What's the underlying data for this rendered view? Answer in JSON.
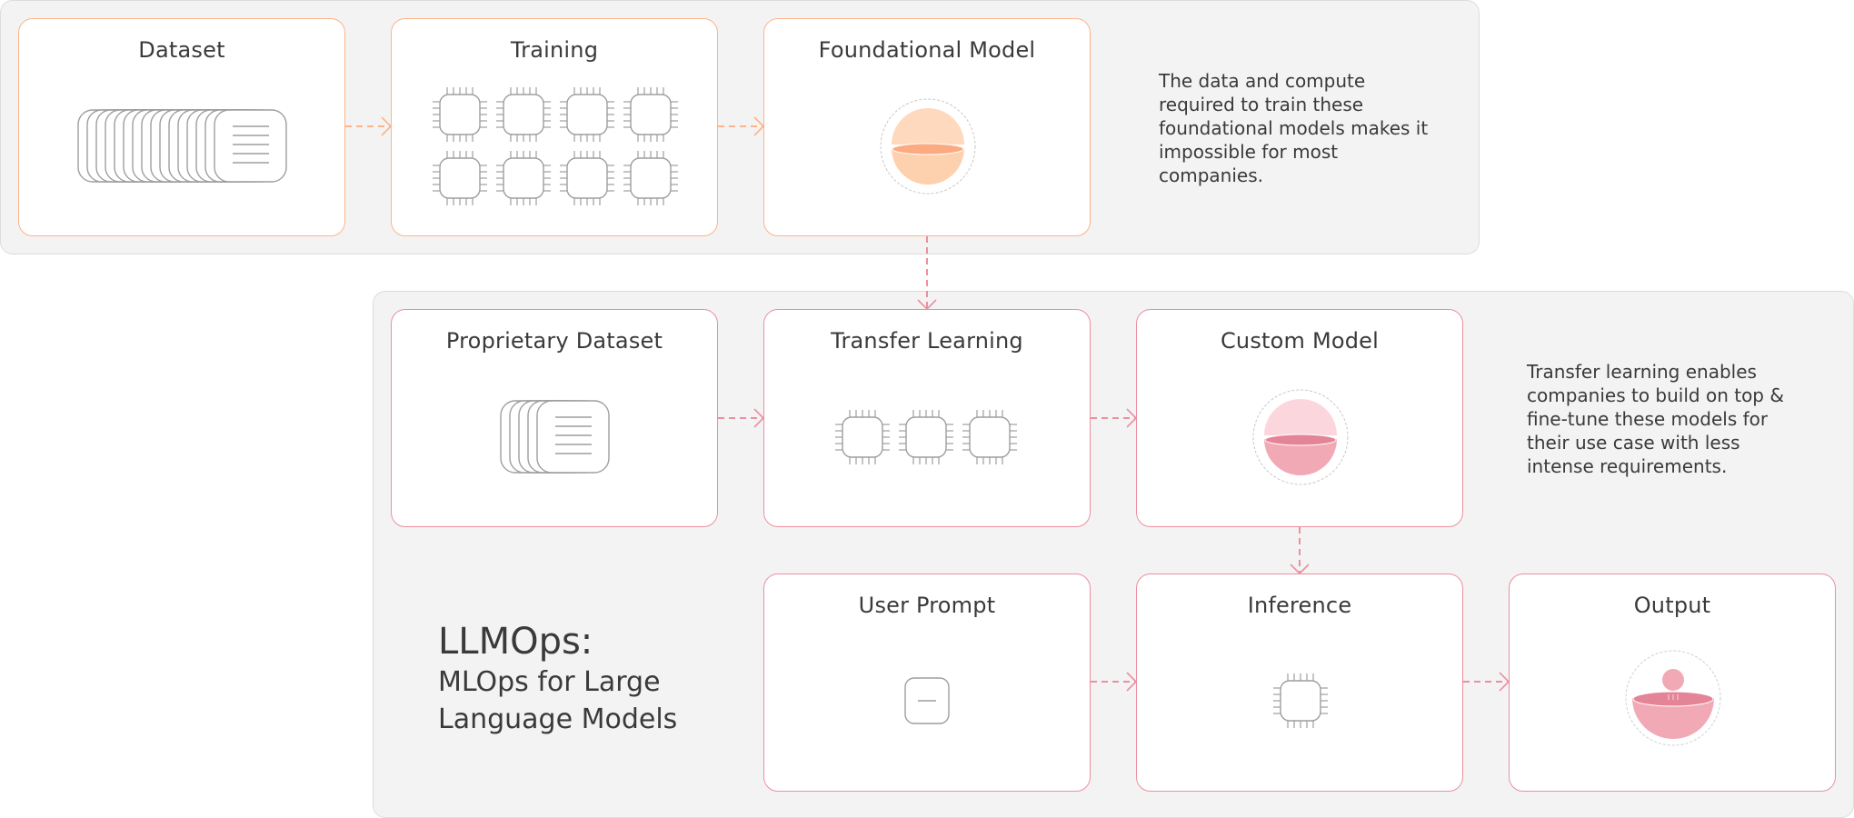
{
  "colors": {
    "top_accent": "#fdb48a",
    "bottom_accent": "#ec8fa0",
    "panel_bg": "#f3f3f3",
    "icon_stroke": "#9e9e9e",
    "orange_light": "#fed9bd",
    "orange_mid": "#fdd0ae",
    "orange_dark": "#fcaa82",
    "pink_light": "#fbd6dd",
    "pink_mid": "#f1aab5",
    "pink_dark": "#e48597"
  },
  "top_panel": {
    "boxes": [
      {
        "id": "dataset",
        "title": "Dataset",
        "icon": "document-stack-icon"
      },
      {
        "id": "training",
        "title": "Training",
        "icon": "chip-grid-icon"
      },
      {
        "id": "foundational_model",
        "title": "Foundational Model",
        "icon": "model-sphere-icon"
      }
    ],
    "note_lines": [
      "The data and compute",
      "required to train these",
      "foundational models makes it",
      "impossible for most",
      "companies."
    ]
  },
  "bottom_panel": {
    "heading": {
      "title": "LLMOps:",
      "subtitle_line1": "MLOps for Large",
      "subtitle_line2": "Language Models"
    },
    "boxes": [
      {
        "id": "proprietary_dataset",
        "title": "Proprietary Dataset",
        "icon": "document-stack-icon"
      },
      {
        "id": "transfer_learning",
        "title": "Transfer Learning",
        "icon": "chip-row-icon"
      },
      {
        "id": "custom_model",
        "title": "Custom Model",
        "icon": "model-sphere-icon"
      },
      {
        "id": "user_prompt",
        "title": "User Prompt",
        "icon": "prompt-icon"
      },
      {
        "id": "inference",
        "title": "Inference",
        "icon": "chip-icon"
      },
      {
        "id": "output",
        "title": "Output",
        "icon": "output-bowl-icon"
      }
    ],
    "note_lines": [
      "Transfer learning enables",
      "companies to build on top &",
      "fine-tune these models for",
      "their use case with less",
      "intense requirements."
    ]
  },
  "edges": [
    {
      "from": "Dataset",
      "to": "Training"
    },
    {
      "from": "Training",
      "to": "Foundational Model"
    },
    {
      "from": "Foundational Model",
      "to": "Transfer Learning"
    },
    {
      "from": "Proprietary Dataset",
      "to": "Transfer Learning"
    },
    {
      "from": "Transfer Learning",
      "to": "Custom Model"
    },
    {
      "from": "Custom Model",
      "to": "Inference"
    },
    {
      "from": "User Prompt",
      "to": "Inference"
    },
    {
      "from": "Inference",
      "to": "Output"
    }
  ]
}
